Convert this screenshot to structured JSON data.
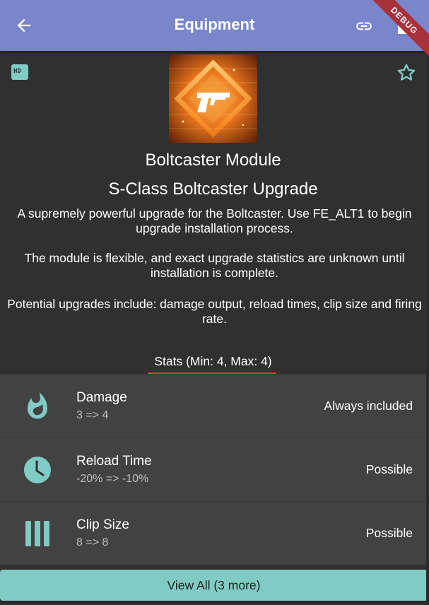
{
  "appbar": {
    "title": "Equipment",
    "debug_label": "DEBUG"
  },
  "badge": {
    "hd_label": "HD"
  },
  "item": {
    "name": "Boltcaster Module",
    "subtitle": "S-Class Boltcaster Upgrade",
    "description": [
      "A supremely powerful upgrade for the Boltcaster. Use FE_ALT1 to begin upgrade installation process.",
      "The module is flexible, and exact upgrade statistics are unknown until installation is complete.",
      "Potential upgrades include: damage output, reload times, clip size and firing rate."
    ]
  },
  "stats": {
    "heading": "Stats (Min: 4, Max: 4)",
    "rows": [
      {
        "label": "Damage",
        "value": "3 => 4",
        "status": "Always included",
        "icon": "flame-icon"
      },
      {
        "label": "Reload Time",
        "value": "-20% => -10%",
        "status": "Possible",
        "icon": "clock-icon"
      },
      {
        "label": "Clip Size",
        "value": "8 => 8",
        "status": "Possible",
        "icon": "clip-bars-icon"
      }
    ]
  },
  "footer": {
    "view_all_label": "View All (3 more)"
  },
  "colors": {
    "appbar": "#7986cb",
    "accent": "#80cbc4",
    "background": "#303030",
    "row": "#424242",
    "underline": "#e53935"
  }
}
